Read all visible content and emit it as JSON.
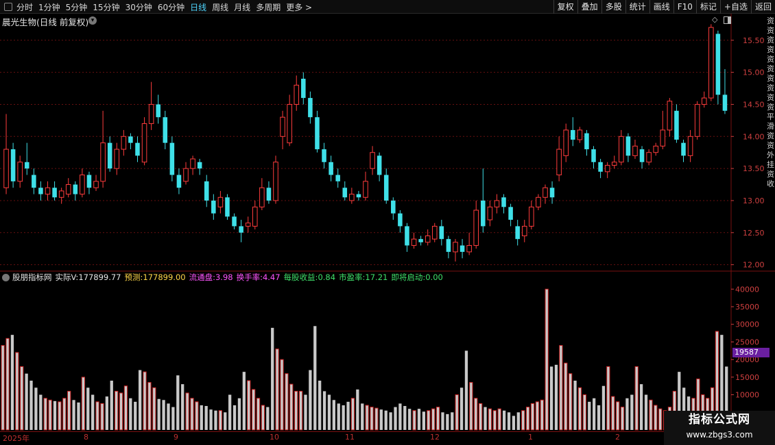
{
  "toolbar": {
    "timeframes": [
      {
        "label": "分时",
        "active": false
      },
      {
        "label": "1分钟",
        "active": false
      },
      {
        "label": "5分钟",
        "active": false
      },
      {
        "label": "15分钟",
        "active": false
      },
      {
        "label": "30分钟",
        "active": false
      },
      {
        "label": "60分钟",
        "active": false
      },
      {
        "label": "日线",
        "active": true
      },
      {
        "label": "周线",
        "active": false
      },
      {
        "label": "月线",
        "active": false
      },
      {
        "label": "多周期",
        "active": false
      },
      {
        "label": "更多 >",
        "active": false
      }
    ],
    "right_buttons": [
      "复权",
      "叠加",
      "多股",
      "统计",
      "画线",
      "F10",
      "标记",
      "+自选",
      "返回"
    ]
  },
  "stock_title": "晨光生物(日线 前复权)",
  "side_strip_text": "资资资资资资资资资资平滑资资外挂资收",
  "indicator": {
    "name": "股朋指标网",
    "actual_label": "实际V:",
    "actual_value": "177899.77",
    "forecast_label": "预测:",
    "forecast_value": "177899.00",
    "float_label": "流通盘:",
    "float_value": "3.98",
    "turnover_label": "换手率:",
    "turnover_value": "4.47",
    "eps_label": "每股收益:",
    "eps_value": "0.84",
    "pe_label": "市盈率:",
    "pe_value": "17.21",
    "start_label": "即将启动:",
    "start_value": "0.00",
    "volume_marker": "19587"
  },
  "colors": {
    "up": "#ff3c3c",
    "down": "#3fe0e8",
    "grid": "#6a1010",
    "axis_text": "#d04040",
    "volume_up": "#c9c9c9",
    "volume_up_border": "#c72020",
    "badge": "#6a1fa0"
  },
  "date_labels": [
    "2025年",
    "8",
    "9",
    "10",
    "11",
    "12",
    "1",
    "2"
  ],
  "watermark": {
    "title": "指标公式网",
    "url": "www.zbgs3.com"
  },
  "chart_data": [
    {
      "type": "candlestick",
      "title": "晨光生物(日线 前复权)",
      "ylim": [
        11.9,
        15.85
      ],
      "y_ticks": [
        12.0,
        12.5,
        13.0,
        13.5,
        14.0,
        14.5,
        15.0,
        15.5
      ],
      "y_tick_labels": [
        "12.00",
        "12.50",
        "13.00",
        "13.50",
        "14.00",
        "14.50",
        "15.00",
        "15.50"
      ],
      "candles": [
        {
          "o": 13.2,
          "c": 13.8,
          "h": 14.35,
          "l": 13.1
        },
        {
          "o": 13.8,
          "c": 13.3,
          "h": 13.9,
          "l": 13.2
        },
        {
          "o": 13.3,
          "c": 13.6,
          "h": 13.7,
          "l": 13.2
        },
        {
          "o": 13.6,
          "c": 13.5,
          "h": 13.9,
          "l": 13.4
        },
        {
          "o": 13.4,
          "c": 13.2,
          "h": 13.5,
          "l": 13.1
        },
        {
          "o": 13.2,
          "c": 13.1,
          "h": 13.3,
          "l": 13.0
        },
        {
          "o": 13.1,
          "c": 13.2,
          "h": 13.3,
          "l": 13.0
        },
        {
          "o": 13.2,
          "c": 13.05,
          "h": 13.3,
          "l": 13.0
        },
        {
          "o": 13.05,
          "c": 13.15,
          "h": 13.2,
          "l": 12.95
        },
        {
          "o": 13.1,
          "c": 13.25,
          "h": 13.35,
          "l": 13.05
        },
        {
          "o": 13.25,
          "c": 13.1,
          "h": 13.3,
          "l": 13.0
        },
        {
          "o": 13.1,
          "c": 13.4,
          "h": 13.5,
          "l": 13.05
        },
        {
          "o": 13.4,
          "c": 13.2,
          "h": 13.45,
          "l": 13.1
        },
        {
          "o": 13.2,
          "c": 13.3,
          "h": 13.4,
          "l": 13.15
        },
        {
          "o": 13.3,
          "c": 13.9,
          "h": 14.4,
          "l": 13.2
        },
        {
          "o": 13.9,
          "c": 13.5,
          "h": 14.0,
          "l": 13.45
        },
        {
          "o": 13.5,
          "c": 13.8,
          "h": 13.9,
          "l": 13.4
        },
        {
          "o": 13.8,
          "c": 14.0,
          "h": 14.1,
          "l": 13.7
        },
        {
          "o": 14.0,
          "c": 13.9,
          "h": 14.05,
          "l": 13.8
        },
        {
          "o": 13.9,
          "c": 13.7,
          "h": 14.0,
          "l": 13.6
        },
        {
          "o": 13.6,
          "c": 14.2,
          "h": 14.3,
          "l": 13.55
        },
        {
          "o": 14.2,
          "c": 14.5,
          "h": 14.85,
          "l": 14.1
        },
        {
          "o": 14.5,
          "c": 14.3,
          "h": 14.65,
          "l": 14.2
        },
        {
          "o": 14.3,
          "c": 13.9,
          "h": 14.4,
          "l": 13.8
        },
        {
          "o": 13.9,
          "c": 13.4,
          "h": 14.0,
          "l": 13.3
        },
        {
          "o": 13.4,
          "c": 13.2,
          "h": 13.5,
          "l": 13.1
        },
        {
          "o": 13.3,
          "c": 13.5,
          "h": 13.6,
          "l": 13.25
        },
        {
          "o": 13.5,
          "c": 13.65,
          "h": 13.7,
          "l": 13.4
        },
        {
          "o": 13.6,
          "c": 13.5,
          "h": 13.65,
          "l": 13.4
        },
        {
          "o": 13.3,
          "c": 13.0,
          "h": 13.4,
          "l": 12.9
        },
        {
          "o": 13.0,
          "c": 12.8,
          "h": 13.1,
          "l": 12.7
        },
        {
          "o": 12.9,
          "c": 13.05,
          "h": 13.15,
          "l": 12.8
        },
        {
          "o": 13.05,
          "c": 12.75,
          "h": 13.1,
          "l": 12.7
        },
        {
          "o": 12.75,
          "c": 12.6,
          "h": 12.8,
          "l": 12.55
        },
        {
          "o": 12.6,
          "c": 12.5,
          "h": 12.7,
          "l": 12.35
        },
        {
          "o": 12.6,
          "c": 12.65,
          "h": 12.75,
          "l": 12.5
        },
        {
          "o": 12.6,
          "c": 12.9,
          "h": 13.0,
          "l": 12.55
        },
        {
          "o": 12.9,
          "c": 13.2,
          "h": 13.35,
          "l": 12.85
        },
        {
          "o": 13.2,
          "c": 13.0,
          "h": 13.3,
          "l": 12.95
        },
        {
          "o": 13.0,
          "c": 13.6,
          "h": 13.7,
          "l": 12.95
        },
        {
          "o": 14.0,
          "c": 14.3,
          "h": 14.4,
          "l": 13.8
        },
        {
          "o": 13.9,
          "c": 14.5,
          "h": 14.65,
          "l": 13.85
        },
        {
          "o": 14.5,
          "c": 14.8,
          "h": 14.95,
          "l": 14.4
        },
        {
          "o": 14.9,
          "c": 14.6,
          "h": 15.0,
          "l": 14.5
        },
        {
          "o": 14.6,
          "c": 14.3,
          "h": 14.7,
          "l": 14.2
        },
        {
          "o": 14.3,
          "c": 13.8,
          "h": 14.4,
          "l": 13.75
        },
        {
          "o": 13.8,
          "c": 13.6,
          "h": 13.9,
          "l": 13.5
        },
        {
          "o": 13.6,
          "c": 13.4,
          "h": 13.7,
          "l": 13.3
        },
        {
          "o": 13.4,
          "c": 13.3,
          "h": 13.5,
          "l": 13.2
        },
        {
          "o": 13.2,
          "c": 13.05,
          "h": 13.3,
          "l": 13.0
        },
        {
          "o": 13.0,
          "c": 13.1,
          "h": 13.2,
          "l": 12.95
        },
        {
          "o": 13.1,
          "c": 13.05,
          "h": 13.15,
          "l": 13.0
        },
        {
          "o": 13.05,
          "c": 13.3,
          "h": 13.45,
          "l": 13.0
        },
        {
          "o": 13.5,
          "c": 13.75,
          "h": 13.85,
          "l": 13.4
        },
        {
          "o": 13.7,
          "c": 13.4,
          "h": 13.75,
          "l": 13.3
        },
        {
          "o": 13.4,
          "c": 13.0,
          "h": 13.5,
          "l": 12.95
        },
        {
          "o": 13.0,
          "c": 12.8,
          "h": 13.05,
          "l": 12.7
        },
        {
          "o": 12.8,
          "c": 12.6,
          "h": 12.85,
          "l": 12.5
        },
        {
          "o": 12.6,
          "c": 12.3,
          "h": 12.65,
          "l": 12.2
        },
        {
          "o": 12.3,
          "c": 12.4,
          "h": 12.5,
          "l": 12.25
        },
        {
          "o": 12.4,
          "c": 12.35,
          "h": 12.45,
          "l": 12.3
        },
        {
          "o": 12.35,
          "c": 12.45,
          "h": 12.55,
          "l": 12.3
        },
        {
          "o": 12.4,
          "c": 12.6,
          "h": 12.65,
          "l": 12.35
        },
        {
          "o": 12.6,
          "c": 12.4,
          "h": 12.7,
          "l": 12.3
        },
        {
          "o": 12.4,
          "c": 12.2,
          "h": 12.45,
          "l": 12.1
        },
        {
          "o": 12.2,
          "c": 12.35,
          "h": 12.4,
          "l": 12.05
        },
        {
          "o": 12.3,
          "c": 12.2,
          "h": 12.4,
          "l": 12.1
        },
        {
          "o": 12.2,
          "c": 12.3,
          "h": 12.5,
          "l": 12.15
        },
        {
          "o": 12.3,
          "c": 12.85,
          "h": 13.0,
          "l": 12.25
        },
        {
          "o": 13.0,
          "c": 12.6,
          "h": 13.5,
          "l": 12.5
        },
        {
          "o": 12.7,
          "c": 12.9,
          "h": 13.0,
          "l": 12.6
        },
        {
          "o": 12.9,
          "c": 13.0,
          "h": 13.1,
          "l": 12.8
        },
        {
          "o": 13.05,
          "c": 12.9,
          "h": 13.1,
          "l": 12.8
        },
        {
          "o": 12.9,
          "c": 12.7,
          "h": 12.95,
          "l": 12.6
        },
        {
          "o": 12.6,
          "c": 12.4,
          "h": 12.7,
          "l": 12.3
        },
        {
          "o": 12.45,
          "c": 12.6,
          "h": 12.7,
          "l": 12.35
        },
        {
          "o": 12.6,
          "c": 12.9,
          "h": 13.0,
          "l": 12.55
        },
        {
          "o": 12.9,
          "c": 13.05,
          "h": 13.1,
          "l": 12.85
        },
        {
          "o": 13.05,
          "c": 13.2,
          "h": 13.25,
          "l": 12.95
        },
        {
          "o": 13.2,
          "c": 13.05,
          "h": 13.3,
          "l": 12.95
        },
        {
          "o": 13.4,
          "c": 13.8,
          "h": 14.0,
          "l": 13.3
        },
        {
          "o": 13.7,
          "c": 14.1,
          "h": 14.2,
          "l": 13.6
        },
        {
          "o": 14.1,
          "c": 13.95,
          "h": 14.3,
          "l": 13.85
        },
        {
          "o": 13.95,
          "c": 14.1,
          "h": 14.15,
          "l": 13.9
        },
        {
          "o": 14.05,
          "c": 13.8,
          "h": 14.1,
          "l": 13.7
        },
        {
          "o": 13.8,
          "c": 13.6,
          "h": 13.85,
          "l": 13.5
        },
        {
          "o": 13.6,
          "c": 13.45,
          "h": 13.65,
          "l": 13.35
        },
        {
          "o": 13.45,
          "c": 13.55,
          "h": 13.6,
          "l": 13.35
        },
        {
          "o": 13.55,
          "c": 13.6,
          "h": 13.7,
          "l": 13.5
        },
        {
          "o": 13.6,
          "c": 14.0,
          "h": 14.1,
          "l": 13.55
        },
        {
          "o": 14.0,
          "c": 13.7,
          "h": 14.05,
          "l": 13.6
        },
        {
          "o": 13.7,
          "c": 13.85,
          "h": 13.95,
          "l": 13.65
        },
        {
          "o": 13.8,
          "c": 13.6,
          "h": 13.85,
          "l": 13.5
        },
        {
          "o": 13.6,
          "c": 13.75,
          "h": 13.8,
          "l": 13.55
        },
        {
          "o": 13.75,
          "c": 13.85,
          "h": 13.9,
          "l": 13.7
        },
        {
          "o": 13.85,
          "c": 14.1,
          "h": 14.4,
          "l": 13.8
        },
        {
          "o": 14.1,
          "c": 14.55,
          "h": 14.6,
          "l": 14.0
        },
        {
          "o": 14.4,
          "c": 13.95,
          "h": 14.5,
          "l": 13.9
        },
        {
          "o": 13.9,
          "c": 13.7,
          "h": 13.95,
          "l": 13.6
        },
        {
          "o": 13.7,
          "c": 14.0,
          "h": 14.1,
          "l": 13.6
        },
        {
          "o": 14.0,
          "c": 14.5,
          "h": 14.55,
          "l": 13.95
        },
        {
          "o": 14.5,
          "c": 14.6,
          "h": 14.7,
          "l": 14.45
        },
        {
          "o": 14.6,
          "c": 15.7,
          "h": 15.75,
          "l": 14.55
        },
        {
          "o": 15.6,
          "c": 14.65,
          "h": 15.65,
          "l": 14.5
        },
        {
          "o": 14.65,
          "c": 14.4,
          "h": 15.05,
          "l": 14.35
        }
      ]
    },
    {
      "type": "bar",
      "title": "股朋指标网",
      "ylim": [
        0,
        42000
      ],
      "y_ticks": [
        10000,
        15000,
        20000,
        25000,
        30000,
        35000,
        40000
      ],
      "y_tick_labels": [
        "10000",
        "15000",
        "20000",
        "25000",
        "30000",
        "35000",
        "40000"
      ],
      "values": [
        24000,
        26000,
        27000,
        22000,
        18000,
        16000,
        14000,
        12000,
        10000,
        9000,
        8500,
        8200,
        8000,
        9000,
        11000,
        8500,
        7800,
        15000,
        12000,
        10000,
        8000,
        7500,
        9500,
        14000,
        11000,
        10500,
        12500,
        9000,
        8000,
        17000,
        16500,
        13500,
        12000,
        8800,
        8500,
        7500,
        6500,
        15500,
        13000,
        10500,
        9000,
        8000,
        7000,
        6800,
        5800,
        5500,
        5500,
        5000,
        10000,
        7000,
        9000,
        16500,
        14000,
        11500,
        9000,
        7000,
        6500,
        29000,
        23000,
        20000,
        16000,
        13000,
        11000,
        11000,
        10000,
        17000,
        29500,
        14000,
        11000,
        10000,
        8500,
        7500,
        7000,
        8000,
        9000,
        11500,
        7500,
        7000,
        6500,
        6200,
        5800,
        5500,
        5000,
        6500,
        7500,
        6800,
        6000,
        5500,
        6000,
        5200,
        5500,
        6000,
        6500,
        5000,
        4500,
        5000,
        10000,
        12000,
        22500,
        13500,
        9000,
        7500,
        6500,
        6000,
        5500,
        6000,
        5500,
        5000,
        4000,
        5000,
        5500,
        6500,
        7500,
        8000,
        8500,
        40000,
        18000,
        18500,
        24000,
        19000,
        16000,
        14000,
        12000,
        10000,
        8000,
        9000,
        7000,
        12500,
        18000,
        9500,
        8000,
        6500,
        9000,
        10000,
        18000,
        13000,
        10000,
        8500,
        7000,
        6000,
        5500,
        6500,
        11000,
        16500,
        12000,
        9500,
        9000,
        14500,
        10000,
        9000,
        12000,
        28000,
        27000,
        18000
      ],
      "up_flags_note_omitted": true,
      "marker_value": 19587
    }
  ]
}
